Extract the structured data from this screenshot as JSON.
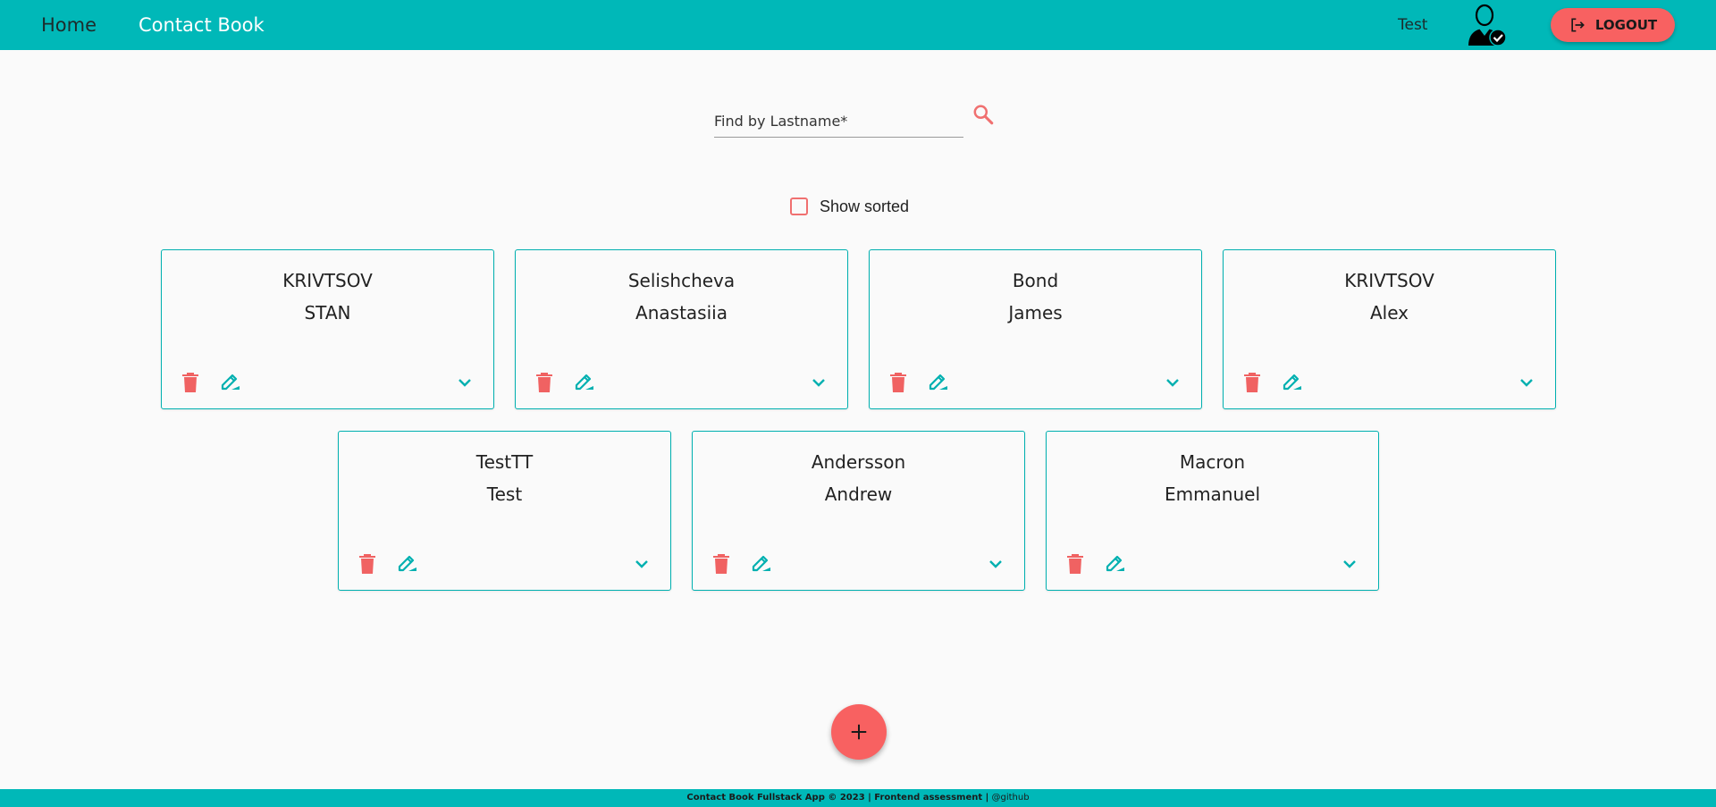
{
  "header": {
    "home_label": "Home",
    "book_label": "Contact Book",
    "user_name": "Test",
    "logout_label": "LOGOUT"
  },
  "search": {
    "placeholder": "Find by Lastname*",
    "value": ""
  },
  "sort": {
    "label": "Show sorted",
    "checked": false
  },
  "contacts": [
    {
      "last": "KRIVTSOV",
      "first": "STAN"
    },
    {
      "last": "Selishcheva",
      "first": "Anastasiia"
    },
    {
      "last": "Bond",
      "first": "James"
    },
    {
      "last": "KRIVTSOV",
      "first": "Alex"
    },
    {
      "last": "TestTT",
      "first": "Test"
    },
    {
      "last": "Andersson",
      "first": "Andrew"
    },
    {
      "last": "Macron",
      "first": "Emmanuel"
    }
  ],
  "footer": {
    "text": "Contact Book Fullstack App © 2023 | Frontend assessment |",
    "link": "@github"
  },
  "colors": {
    "primary": "#00b8b8",
    "accent": "#f86161",
    "background": "#fafafa"
  }
}
